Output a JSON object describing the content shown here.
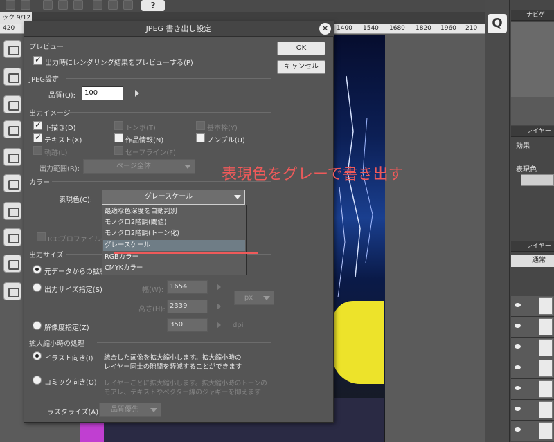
{
  "app": {
    "doc_tab": "ック 9/12",
    "help_label": "?",
    "q_label": "Q",
    "ruler_ticks": [
      "420",
      "1400",
      "1540",
      "1680",
      "1820",
      "1960",
      "210"
    ]
  },
  "right_panels": {
    "navigator_title": "ナビゲ",
    "layer_prop_title": "レイヤー",
    "effect_label": "効果",
    "color_label": "表現色",
    "layers_title": "レイヤー",
    "blend_mode": "通常"
  },
  "dialog": {
    "title": "JPEG 書き出し設定",
    "ok_label": "OK",
    "cancel_label": "キャンセル",
    "preview": {
      "section": "プレビュー",
      "checkbox_label": "出力時にレンダリング結果をプレビューする(P)",
      "checked": true
    },
    "jpeg": {
      "section": "JPEG設定",
      "quality_label": "品質(Q):",
      "quality_value": "100"
    },
    "output_image": {
      "section": "出力イメージ",
      "items": [
        {
          "label": "下描き(D)",
          "checked": true,
          "enabled": true
        },
        {
          "label": "トンボ(T)",
          "checked": false,
          "enabled": false
        },
        {
          "label": "基本枠(Y)",
          "checked": false,
          "enabled": false
        },
        {
          "label": "テキスト(X)",
          "checked": true,
          "enabled": true
        },
        {
          "label": "作品情報(N)",
          "checked": false,
          "enabled": true
        },
        {
          "label": "ノンブル(U)",
          "checked": false,
          "enabled": true
        },
        {
          "label": "軌跡(L)",
          "checked": false,
          "enabled": false
        },
        {
          "label": "セーフライン(F)",
          "checked": false,
          "enabled": false
        }
      ],
      "range_label": "出力範囲(R):",
      "range_value": "ページ全体"
    },
    "color": {
      "section": "カラー",
      "expression_label": "表現色(C):",
      "expression_value": "グレースケール",
      "icc_label": "ICCプロファイルの埋",
      "options": [
        "最適な色深度を自動判別",
        "モノクロ2階調(閾値)",
        "モノクロ2階調(トーン化)",
        "グレースケール",
        "RGBカラー",
        "CMYKカラー"
      ],
      "selected_index": 3
    },
    "output_size": {
      "section": "出力サイズ",
      "radio_original": "元データからの拡縮",
      "radio_size": "出力サイズ指定(S)",
      "width_label": "幅(W):",
      "width_value": "1654",
      "height_label": "高さ(H):",
      "height_value": "2339",
      "unit": "px",
      "radio_resolution": "解像度指定(Z)",
      "resolution_value": "350",
      "resolution_unit": "dpi"
    },
    "scaling": {
      "section": "拡大縮小時の処理",
      "illust_label": "イラスト向き(I)",
      "illust_desc_1": "統合した画像を拡大縮小します。拡大縮小時の",
      "illust_desc_2": "レイヤー同士の隙間を軽減することができます",
      "comic_label": "コミック向き(O)",
      "comic_desc_1": "レイヤーごとに拡大縮小します。拡大縮小時のトーンの",
      "comic_desc_2": "モアレ、テキストやベクター線のジャギーを抑えます",
      "rasterize_label": "ラスタライズ(A):",
      "rasterize_value": "品質優先"
    }
  },
  "annotation": {
    "text": "表現色をグレーで書き出す",
    "color": "#ef5a5a"
  }
}
